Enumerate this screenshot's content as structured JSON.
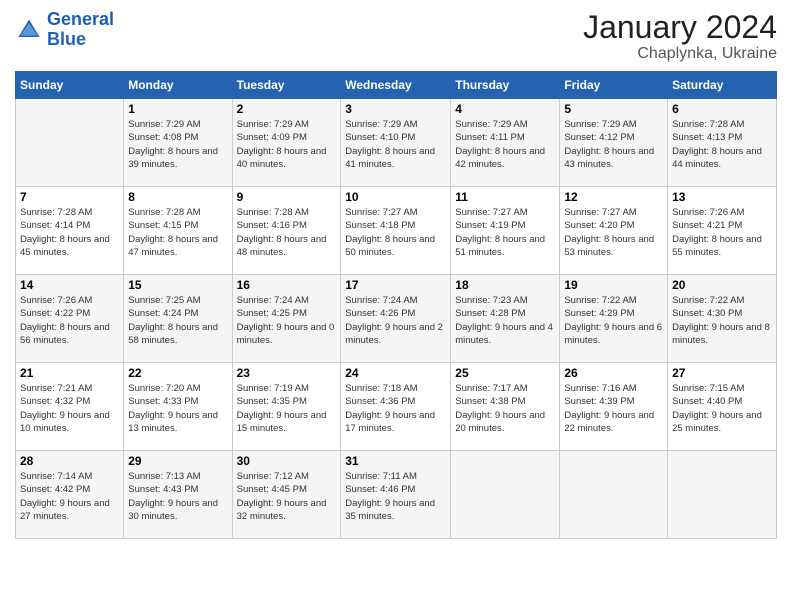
{
  "logo": {
    "line1": "General",
    "line2": "Blue"
  },
  "title": "January 2024",
  "subtitle": "Chaplynka, Ukraine",
  "days_header": [
    "Sunday",
    "Monday",
    "Tuesday",
    "Wednesday",
    "Thursday",
    "Friday",
    "Saturday"
  ],
  "weeks": [
    [
      {
        "day": "",
        "sunrise": "",
        "sunset": "",
        "daylight": ""
      },
      {
        "day": "1",
        "sunrise": "Sunrise: 7:29 AM",
        "sunset": "Sunset: 4:08 PM",
        "daylight": "Daylight: 8 hours and 39 minutes."
      },
      {
        "day": "2",
        "sunrise": "Sunrise: 7:29 AM",
        "sunset": "Sunset: 4:09 PM",
        "daylight": "Daylight: 8 hours and 40 minutes."
      },
      {
        "day": "3",
        "sunrise": "Sunrise: 7:29 AM",
        "sunset": "Sunset: 4:10 PM",
        "daylight": "Daylight: 8 hours and 41 minutes."
      },
      {
        "day": "4",
        "sunrise": "Sunrise: 7:29 AM",
        "sunset": "Sunset: 4:11 PM",
        "daylight": "Daylight: 8 hours and 42 minutes."
      },
      {
        "day": "5",
        "sunrise": "Sunrise: 7:29 AM",
        "sunset": "Sunset: 4:12 PM",
        "daylight": "Daylight: 8 hours and 43 minutes."
      },
      {
        "day": "6",
        "sunrise": "Sunrise: 7:28 AM",
        "sunset": "Sunset: 4:13 PM",
        "daylight": "Daylight: 8 hours and 44 minutes."
      }
    ],
    [
      {
        "day": "7",
        "sunrise": "Sunrise: 7:28 AM",
        "sunset": "Sunset: 4:14 PM",
        "daylight": "Daylight: 8 hours and 45 minutes."
      },
      {
        "day": "8",
        "sunrise": "Sunrise: 7:28 AM",
        "sunset": "Sunset: 4:15 PM",
        "daylight": "Daylight: 8 hours and 47 minutes."
      },
      {
        "day": "9",
        "sunrise": "Sunrise: 7:28 AM",
        "sunset": "Sunset: 4:16 PM",
        "daylight": "Daylight: 8 hours and 48 minutes."
      },
      {
        "day": "10",
        "sunrise": "Sunrise: 7:27 AM",
        "sunset": "Sunset: 4:18 PM",
        "daylight": "Daylight: 8 hours and 50 minutes."
      },
      {
        "day": "11",
        "sunrise": "Sunrise: 7:27 AM",
        "sunset": "Sunset: 4:19 PM",
        "daylight": "Daylight: 8 hours and 51 minutes."
      },
      {
        "day": "12",
        "sunrise": "Sunrise: 7:27 AM",
        "sunset": "Sunset: 4:20 PM",
        "daylight": "Daylight: 8 hours and 53 minutes."
      },
      {
        "day": "13",
        "sunrise": "Sunrise: 7:26 AM",
        "sunset": "Sunset: 4:21 PM",
        "daylight": "Daylight: 8 hours and 55 minutes."
      }
    ],
    [
      {
        "day": "14",
        "sunrise": "Sunrise: 7:26 AM",
        "sunset": "Sunset: 4:22 PM",
        "daylight": "Daylight: 8 hours and 56 minutes."
      },
      {
        "day": "15",
        "sunrise": "Sunrise: 7:25 AM",
        "sunset": "Sunset: 4:24 PM",
        "daylight": "Daylight: 8 hours and 58 minutes."
      },
      {
        "day": "16",
        "sunrise": "Sunrise: 7:24 AM",
        "sunset": "Sunset: 4:25 PM",
        "daylight": "Daylight: 9 hours and 0 minutes."
      },
      {
        "day": "17",
        "sunrise": "Sunrise: 7:24 AM",
        "sunset": "Sunset: 4:26 PM",
        "daylight": "Daylight: 9 hours and 2 minutes."
      },
      {
        "day": "18",
        "sunrise": "Sunrise: 7:23 AM",
        "sunset": "Sunset: 4:28 PM",
        "daylight": "Daylight: 9 hours and 4 minutes."
      },
      {
        "day": "19",
        "sunrise": "Sunrise: 7:22 AM",
        "sunset": "Sunset: 4:29 PM",
        "daylight": "Daylight: 9 hours and 6 minutes."
      },
      {
        "day": "20",
        "sunrise": "Sunrise: 7:22 AM",
        "sunset": "Sunset: 4:30 PM",
        "daylight": "Daylight: 9 hours and 8 minutes."
      }
    ],
    [
      {
        "day": "21",
        "sunrise": "Sunrise: 7:21 AM",
        "sunset": "Sunset: 4:32 PM",
        "daylight": "Daylight: 9 hours and 10 minutes."
      },
      {
        "day": "22",
        "sunrise": "Sunrise: 7:20 AM",
        "sunset": "Sunset: 4:33 PM",
        "daylight": "Daylight: 9 hours and 13 minutes."
      },
      {
        "day": "23",
        "sunrise": "Sunrise: 7:19 AM",
        "sunset": "Sunset: 4:35 PM",
        "daylight": "Daylight: 9 hours and 15 minutes."
      },
      {
        "day": "24",
        "sunrise": "Sunrise: 7:18 AM",
        "sunset": "Sunset: 4:36 PM",
        "daylight": "Daylight: 9 hours and 17 minutes."
      },
      {
        "day": "25",
        "sunrise": "Sunrise: 7:17 AM",
        "sunset": "Sunset: 4:38 PM",
        "daylight": "Daylight: 9 hours and 20 minutes."
      },
      {
        "day": "26",
        "sunrise": "Sunrise: 7:16 AM",
        "sunset": "Sunset: 4:39 PM",
        "daylight": "Daylight: 9 hours and 22 minutes."
      },
      {
        "day": "27",
        "sunrise": "Sunrise: 7:15 AM",
        "sunset": "Sunset: 4:40 PM",
        "daylight": "Daylight: 9 hours and 25 minutes."
      }
    ],
    [
      {
        "day": "28",
        "sunrise": "Sunrise: 7:14 AM",
        "sunset": "Sunset: 4:42 PM",
        "daylight": "Daylight: 9 hours and 27 minutes."
      },
      {
        "day": "29",
        "sunrise": "Sunrise: 7:13 AM",
        "sunset": "Sunset: 4:43 PM",
        "daylight": "Daylight: 9 hours and 30 minutes."
      },
      {
        "day": "30",
        "sunrise": "Sunrise: 7:12 AM",
        "sunset": "Sunset: 4:45 PM",
        "daylight": "Daylight: 9 hours and 32 minutes."
      },
      {
        "day": "31",
        "sunrise": "Sunrise: 7:11 AM",
        "sunset": "Sunset: 4:46 PM",
        "daylight": "Daylight: 9 hours and 35 minutes."
      },
      {
        "day": "",
        "sunrise": "",
        "sunset": "",
        "daylight": ""
      },
      {
        "day": "",
        "sunrise": "",
        "sunset": "",
        "daylight": ""
      },
      {
        "day": "",
        "sunrise": "",
        "sunset": "",
        "daylight": ""
      }
    ]
  ]
}
